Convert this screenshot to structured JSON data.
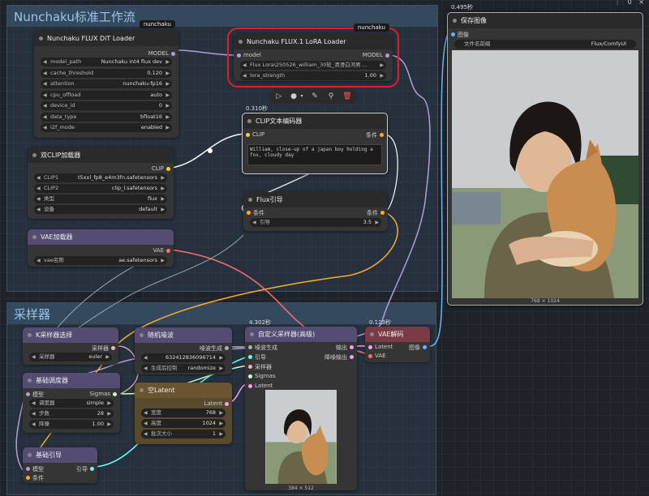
{
  "groups": {
    "main": "Nunchaku标准工作流",
    "sampler": "采样器"
  },
  "dit": {
    "badge": "nunchaku",
    "title": "Nunchaku FLUX DiT Loader",
    "out": "MODEL",
    "widgets": [
      {
        "label": "model_path",
        "value": "Nunchaku int4 flux dev"
      },
      {
        "label": "cache_threshold",
        "value": "0.120"
      },
      {
        "label": "attention",
        "value": "nunchaku-fp16"
      },
      {
        "label": "cpu_offload",
        "value": "auto"
      },
      {
        "label": "device_id",
        "value": "0"
      },
      {
        "label": "data_type",
        "value": "bfloat16"
      },
      {
        "label": "i2f_mode",
        "value": "enabled"
      }
    ]
  },
  "lora": {
    "badge": "nunchaku",
    "title": "Nunchaku FLUX.1 LoRA Loader",
    "in": "model",
    "out": "MODEL",
    "lora_name": "Flux Lora\\250526_william_30轮_清澄白河男 ...",
    "strength_label": "lora_strength",
    "strength": "1.00"
  },
  "clip_loader": {
    "title": "双CLIP加载器",
    "out": "CLIP",
    "widgets": [
      {
        "label": "CLIP1",
        "value": "t5xxl_fp8_e4m3fn.safetensors"
      },
      {
        "label": "CLIP2",
        "value": "clip_l.safetensors"
      },
      {
        "label": "类型",
        "value": "flux"
      },
      {
        "label": "设备",
        "value": "default"
      }
    ]
  },
  "vae_loader": {
    "title": "VAE加载器",
    "out": "VAE",
    "label": "vae名称",
    "value": "ae.safetensors"
  },
  "clip_enc": {
    "time": "0.310秒",
    "title": "CLIP文本编码器",
    "in": "CLIP",
    "out": "条件",
    "text": "William, close-up of a japan boy holding a fox, cloudy day"
  },
  "guidance": {
    "title": "Flux引导",
    "in": "条件",
    "out": "条件",
    "label": "引导",
    "value": "3.5"
  },
  "save": {
    "time": "0.495秒",
    "title": "保存图像",
    "in": "图像",
    "label": "文件名前缀",
    "value": "Flux/ComfyUI",
    "footer": "768 × 1024"
  },
  "ksel": {
    "title": "K采样器选择",
    "out": "采样器",
    "label": "采样器",
    "value": "euler"
  },
  "noise": {
    "title": "随机噪波",
    "out": "噪波生成",
    "seed": "632412836096714",
    "ctrl_label": "生成后控制",
    "ctrl": "randomize"
  },
  "sched": {
    "title": "基础调度器",
    "in": "模型",
    "out": "Sigmas",
    "widgets": [
      {
        "label": "调度器",
        "value": "simple"
      },
      {
        "label": "步数",
        "value": "28"
      },
      {
        "label": "降噪",
        "value": "1.00"
      }
    ]
  },
  "guider": {
    "title": "基础引导",
    "ins": [
      "模型",
      "条件"
    ],
    "out": "引导"
  },
  "latent": {
    "title": "空Latent",
    "out": "Latent",
    "widgets": [
      {
        "label": "宽度",
        "value": "768"
      },
      {
        "label": "高度",
        "value": "1024"
      },
      {
        "label": "批次大小",
        "value": "1"
      }
    ]
  },
  "adv": {
    "time": "4.302秒",
    "title": "自定义采样器(高级)",
    "ins": [
      "噪波生成",
      "引导",
      "采样器",
      "Sigmas",
      "Latent"
    ],
    "outs": [
      "输出",
      "降噪输出"
    ],
    "footer": "384 × 512"
  },
  "vaedec": {
    "time": "0.123秒",
    "title": "VAE解码",
    "ins": [
      "Latent",
      "VAE"
    ],
    "out": "图像"
  },
  "topright": {
    "count": "0"
  },
  "colors": {
    "model": "#b39ddb",
    "clip": "#ffd500",
    "cond": "#ffa931",
    "vae": "#ff6e6e",
    "latent": "#ff9cf9",
    "image": "#64b5f6",
    "sampler": "#ecb4b4",
    "sigmas": "#cdffcd",
    "noise": "#b0b0b0",
    "guider": "#66ffff"
  }
}
